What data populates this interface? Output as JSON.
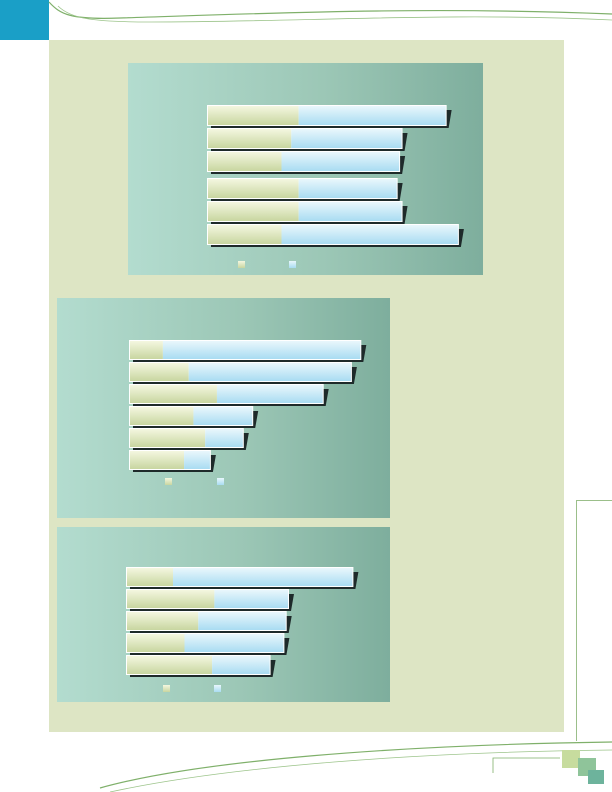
{
  "colors": {
    "accent_tab": "#1a9fc7",
    "panel": "#dde5c4",
    "series_1": "#c8d6a0",
    "series_2": "#a9dcf2",
    "bar_shadow": "#1e2a2a",
    "squares": [
      "#c7dc9e",
      "#8fc49a",
      "#6db39c"
    ]
  },
  "chart_data": [
    {
      "type": "bar",
      "orientation": "horizontal",
      "stacked": true,
      "categories": [
        "",
        "",
        "",
        "",
        "",
        ""
      ],
      "series": [
        {
          "values": [
            37,
            34,
            30,
            37,
            37,
            30
          ]
        },
        {
          "values": [
            60,
            45,
            48,
            40,
            42,
            72
          ]
        }
      ],
      "title": "",
      "xlabel": "",
      "ylabel": "",
      "xlim": [
        0,
        100
      ],
      "legend": "bottom",
      "grid": false
    },
    {
      "type": "bar",
      "orientation": "horizontal",
      "stacked": true,
      "categories": [
        "",
        "",
        "",
        "",
        "",
        ""
      ],
      "series": [
        {
          "values": [
            14,
            25,
            37,
            27,
            32,
            23
          ]
        },
        {
          "values": [
            84,
            69,
            45,
            25,
            16,
            11
          ]
        }
      ],
      "title": "",
      "xlabel": "",
      "ylabel": "",
      "xlim": [
        0,
        100
      ],
      "legend": "bottom",
      "grid": false
    },
    {
      "type": "bar",
      "orientation": "horizontal",
      "stacked": true,
      "categories": [
        "",
        "",
        "",
        "",
        ""
      ],
      "series": [
        {
          "values": [
            20,
            38,
            31,
            25,
            37
          ]
        },
        {
          "values": [
            78,
            32,
            38,
            43,
            25
          ]
        }
      ],
      "title": "",
      "xlabel": "",
      "ylabel": "",
      "xlim": [
        0,
        100
      ],
      "legend": "bottom",
      "grid": false
    }
  ]
}
